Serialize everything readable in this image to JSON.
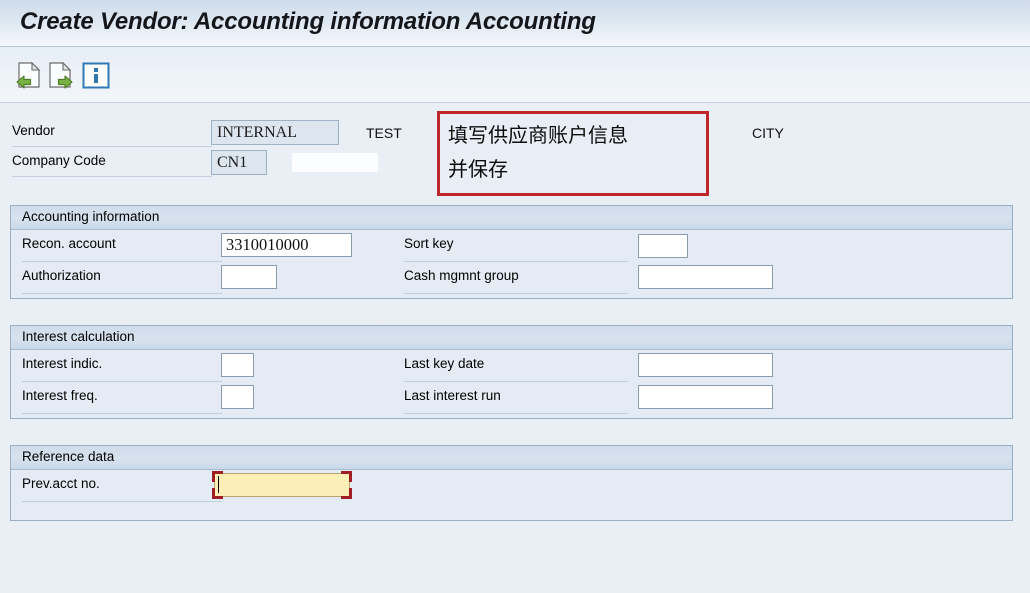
{
  "window": {
    "title": "Create Vendor: Accounting information Accounting"
  },
  "toolbar": {
    "buttons": [
      {
        "name": "previous-screen-icon",
        "tooltip": "Back"
      },
      {
        "name": "next-screen-icon",
        "tooltip": "Next"
      },
      {
        "name": "info-icon",
        "tooltip": "Information"
      }
    ]
  },
  "header": {
    "vendor_label": "Vendor",
    "vendor_value": "INTERNAL",
    "vendor_name": "TEST",
    "vendor_city": "CITY",
    "company_code_label": "Company Code",
    "company_code_value": "CN1",
    "company_code_name": ""
  },
  "annotation": {
    "line1": "填写供应商账户信息",
    "line2": "并保存",
    "border_color": "#c0272d"
  },
  "sections": {
    "accounting": {
      "title": "Accounting information",
      "recon_account_label": "Recon. account",
      "recon_account_value": "3310010000",
      "authorization_label": "Authorization",
      "authorization_value": "",
      "sort_key_label": "Sort key",
      "sort_key_value": "",
      "cash_mgmnt_group_label": "Cash mgmnt group",
      "cash_mgmnt_group_value": ""
    },
    "interest": {
      "title": "Interest calculation",
      "interest_indic_label": "Interest indic.",
      "interest_indic_value": "",
      "interest_freq_label": "Interest freq.",
      "interest_freq_value": "",
      "last_key_date_label": "Last key date",
      "last_key_date_value": "",
      "last_interest_run_label": "Last interest run",
      "last_interest_run_value": ""
    },
    "reference": {
      "title": "Reference data",
      "prev_acct_no_label": "Prev.acct no.",
      "prev_acct_no_value": ""
    }
  },
  "colors": {
    "page_bg": "#eaeef5",
    "group_bg": "#e4ebf4",
    "focus_field_bg": "#fbeeb6",
    "focus_marker": "#a01f24",
    "readonly_field_bg": "#dde5ef"
  }
}
